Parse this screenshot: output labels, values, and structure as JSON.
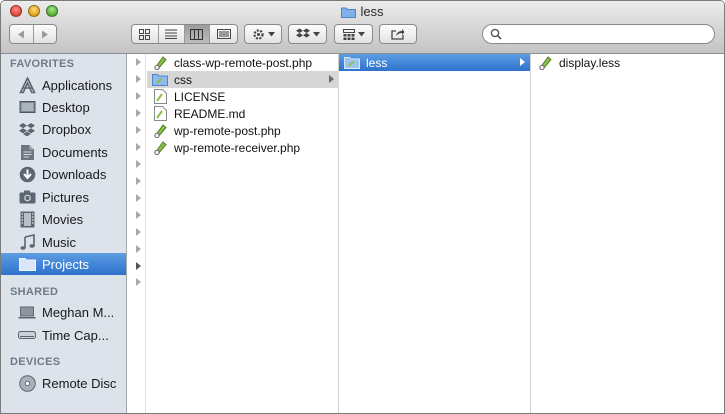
{
  "window": {
    "title": "less"
  },
  "search": {
    "value": "",
    "placeholder": ""
  },
  "sidebar": {
    "favorites_label": "FAVORITES",
    "favorites": [
      {
        "label": "Applications",
        "icon": "applications-icon"
      },
      {
        "label": "Desktop",
        "icon": "desktop-icon"
      },
      {
        "label": "Dropbox",
        "icon": "dropbox-icon"
      },
      {
        "label": "Documents",
        "icon": "documents-icon"
      },
      {
        "label": "Downloads",
        "icon": "downloads-icon"
      },
      {
        "label": "Pictures",
        "icon": "pictures-icon"
      },
      {
        "label": "Movies",
        "icon": "movies-icon"
      },
      {
        "label": "Music",
        "icon": "music-icon"
      },
      {
        "label": "Projects",
        "icon": "folder-icon",
        "selected": true
      }
    ],
    "shared_label": "SHARED",
    "shared": [
      {
        "label": "Meghan M...",
        "icon": "laptop-icon"
      },
      {
        "label": "Time Cap...",
        "icon": "time-capsule-icon"
      }
    ],
    "devices_label": "DEVICES",
    "devices": [
      {
        "label": "Remote Disc",
        "icon": "disc-icon"
      }
    ]
  },
  "columns": {
    "col1": [
      {
        "label": "class-wp-remote-post.php",
        "icon": "php-file-icon"
      },
      {
        "label": "css",
        "icon": "folder-icon",
        "selected": "gray",
        "has_children": true
      },
      {
        "label": "LICENSE",
        "icon": "text-file-icon"
      },
      {
        "label": "README.md",
        "icon": "markdown-file-icon"
      },
      {
        "label": "wp-remote-post.php",
        "icon": "php-file-icon"
      },
      {
        "label": "wp-remote-receiver.php",
        "icon": "php-file-icon"
      }
    ],
    "col2": [
      {
        "label": "less",
        "icon": "folder-icon",
        "selected": "blue",
        "has_children": true
      }
    ],
    "col3": [
      {
        "label": "display.less",
        "icon": "less-file-icon"
      }
    ]
  },
  "colors": {
    "selection_blue": "#3a7fd5",
    "sidebar_bg": "#dce3eb",
    "selection_gray": "#d7d7d7"
  }
}
